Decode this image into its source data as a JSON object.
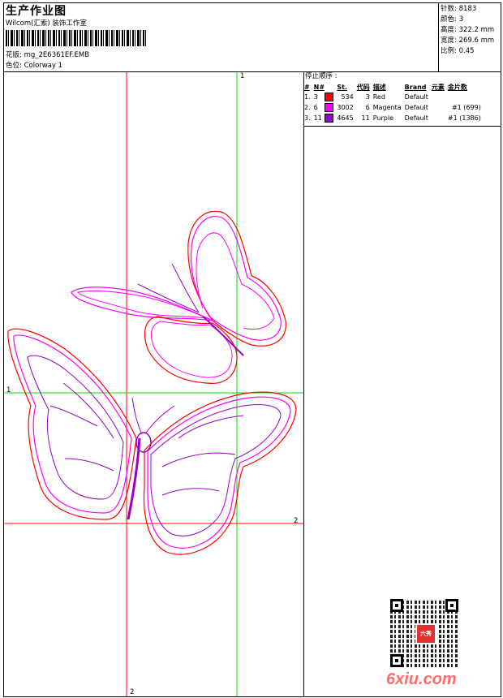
{
  "header": {
    "title": "生产作业图",
    "studio": "Wilcom(汇索) 装饰工作室",
    "design_label": "花版:",
    "design_name": "mg_2E6361EF.EMB",
    "colorway_label": "色位:",
    "colorway_name": "Colorway 1"
  },
  "stats": [
    {
      "label": "针数",
      "value": "8183"
    },
    {
      "label": "颜色",
      "value": "3"
    },
    {
      "label": "高度",
      "value": "322.2 mm"
    },
    {
      "label": "宽度",
      "value": "269.6 mm"
    },
    {
      "label": "比例",
      "value": "0.45"
    }
  ],
  "sequence": {
    "title": "停止顺序 :",
    "headers": [
      "#",
      "N#",
      "St.",
      "代码",
      "描述",
      "Brand",
      "元素",
      "金片数"
    ],
    "rows": [
      {
        "num": "1.",
        "n": "3",
        "swatch": "#ff0000",
        "st": "534",
        "code": "3",
        "desc": "Red",
        "brand": "Default",
        "elem": "",
        "seq": ""
      },
      {
        "num": "2.",
        "n": "6",
        "swatch": "#ff00ff",
        "st": "3002",
        "code": "6",
        "desc": "Magenta",
        "brand": "Default",
        "elem": "",
        "seq": "#1 (699)"
      },
      {
        "num": "3.",
        "n": "11",
        "swatch": "#9900cc",
        "st": "4645",
        "code": "11",
        "desc": "Purple",
        "brand": "Default",
        "elem": "",
        "seq": "#1 (1386)"
      }
    ]
  },
  "markers": {
    "v_green": "1",
    "h_green": "1",
    "h_red": "2",
    "v_red": "2"
  },
  "watermark": "6xiu.com",
  "seal_text": "六秀",
  "colors": {
    "red": "#ff0000",
    "magenta": "#ff00ff",
    "purple": "#9900cc",
    "green": "#00dd00"
  }
}
